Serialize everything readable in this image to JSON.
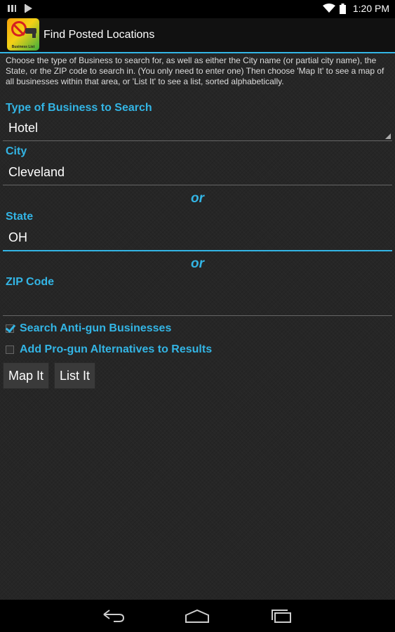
{
  "status_bar": {
    "time": "1:20 PM",
    "icons": [
      "notification-icon",
      "play-store-icon",
      "wifi-icon",
      "battery-icon"
    ]
  },
  "action_bar": {
    "title": "Find Posted Locations",
    "icon_caption": "Business List"
  },
  "instructions": "Choose the type of Business to search for, as well as either the City name (or partial city name), the State, or the ZIP code to search in.  (You only need to enter one)  Then choose 'Map It' to see a map of all businesses within that area, or 'List It' to see a list, sorted alphabetically.",
  "form": {
    "business_type": {
      "label": "Type of Business to Search",
      "selected": "Hotel"
    },
    "city": {
      "label": "City",
      "value": "Cleveland"
    },
    "or_1": "or",
    "state": {
      "label": "State",
      "value": "OH"
    },
    "or_2": "or",
    "zip": {
      "label": "ZIP Code",
      "value": ""
    },
    "search_anti_gun": {
      "label": "Search Anti-gun Businesses",
      "checked": true
    },
    "add_pro_gun": {
      "label": "Add Pro-gun Alternatives to Results",
      "checked": false
    }
  },
  "buttons": {
    "map_it": "Map It",
    "list_it": "List It"
  },
  "colors": {
    "accent": "#33b5e5",
    "background": "#262626",
    "bar": "#000000"
  }
}
